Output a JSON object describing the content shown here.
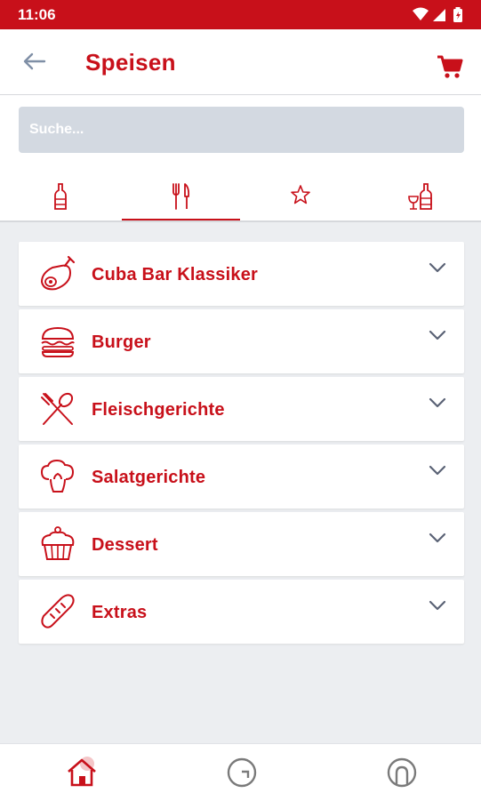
{
  "status_bar": {
    "time": "11:06",
    "icons": [
      "wifi-icon",
      "signal-icon",
      "battery-icon"
    ],
    "color": "#c8101a"
  },
  "app_bar": {
    "title": "Speisen",
    "back_icon": "arrow-left-icon",
    "cart_icon": "shopping-cart-icon"
  },
  "search": {
    "placeholder": "Suche...",
    "value": ""
  },
  "tabs": [
    {
      "name": "drinks",
      "icon": "bottle-icon",
      "active": false
    },
    {
      "name": "food",
      "icon": "fork-knife-icon",
      "active": true
    },
    {
      "name": "favorites",
      "icon": "star-icon",
      "active": false
    },
    {
      "name": "wine",
      "icon": "wine-glass-bottle-icon",
      "active": false
    }
  ],
  "categories": [
    {
      "label": "Cuba Bar Klassiker",
      "icon": "ham-leg-icon"
    },
    {
      "label": "Burger",
      "icon": "burger-icon"
    },
    {
      "label": "Fleischgerichte",
      "icon": "crossed-cutlery-icon"
    },
    {
      "label": "Salatgerichte",
      "icon": "broccoli-icon"
    },
    {
      "label": "Dessert",
      "icon": "cupcake-icon"
    },
    {
      "label": "Extras",
      "icon": "bread-icon"
    }
  ],
  "bottom_nav": [
    {
      "name": "home",
      "icon": "home-icon",
      "active": true
    },
    {
      "name": "orders",
      "icon": "clock-icon",
      "active": false
    },
    {
      "name": "profile",
      "icon": "user-icon",
      "active": false
    }
  ],
  "colors": {
    "accent": "#c8101a",
    "background": "#eceef1",
    "search_bg": "#d3d9e1",
    "inactive_icon": "#8a8a8a"
  }
}
